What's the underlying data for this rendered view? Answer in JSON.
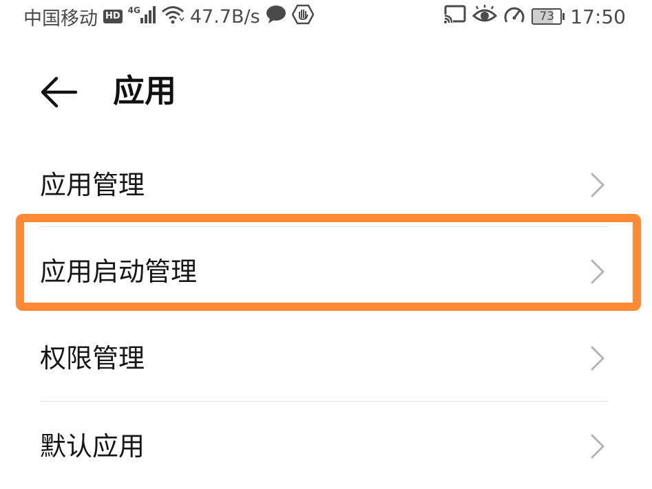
{
  "status_bar": {
    "carrier": "中国移动",
    "hd_badge": "HD",
    "network_type": "4G",
    "net_speed": "47.7B/s",
    "battery_level": "73",
    "battery_fraction": 0.73,
    "time": "17:50",
    "icons": [
      "signal-bars-icon",
      "wifi-icon",
      "chat-bubble-icon",
      "hand-shield-icon",
      "cast-icon",
      "eye-icon",
      "speed-gauge-icon",
      "battery-icon"
    ]
  },
  "header": {
    "back_icon": "arrow-left-icon",
    "title": "应用"
  },
  "menu": {
    "items": [
      {
        "label": "应用管理",
        "icon": "chevron-right-icon"
      },
      {
        "label": "应用启动管理",
        "icon": "chevron-right-icon",
        "highlighted": true
      },
      {
        "label": "权限管理",
        "icon": "chevron-right-icon"
      },
      {
        "label": "默认应用",
        "icon": "chevron-right-icon"
      }
    ]
  },
  "colors": {
    "highlight": "#ff8a33",
    "divider": "#e1e1e1",
    "text": "#161616",
    "status_text": "#4a4a4a",
    "chevron": "#b3b3b3"
  }
}
